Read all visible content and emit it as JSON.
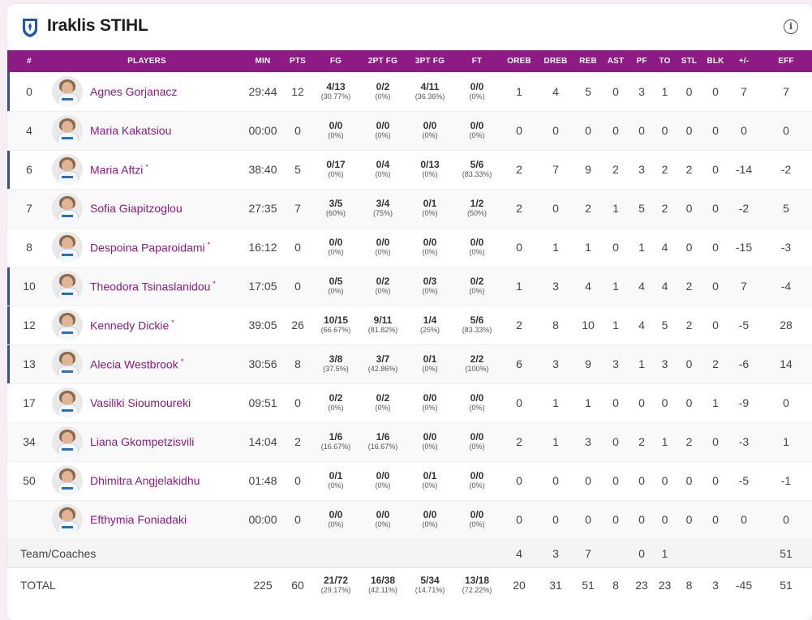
{
  "team": {
    "name": "Iraklis STIHL",
    "logo_icon": "iraklis-crest-icon",
    "info_icon": "info-icon"
  },
  "columns": [
    "#",
    "PLAYERS",
    "MIN",
    "PTS",
    "FG",
    "2PT FG",
    "3PT FG",
    "FT",
    "OREB",
    "DREB",
    "REB",
    "AST",
    "PF",
    "TO",
    "STL",
    "BLK",
    "+/-",
    "EFF"
  ],
  "players": [
    {
      "num": "0",
      "name": "Agnes Gorjanacz",
      "star": "",
      "starter": true,
      "min": "29:44",
      "pts": "12",
      "fg": "4/13",
      "fg_pct": "(30.77%)",
      "fg2": "0/2",
      "fg2_pct": "(0%)",
      "fg3": "4/11",
      "fg3_pct": "(36.36%)",
      "ft": "0/0",
      "ft_pct": "(0%)",
      "oreb": "1",
      "dreb": "4",
      "reb": "5",
      "ast": "0",
      "pf": "3",
      "to": "1",
      "stl": "0",
      "blk": "0",
      "pm": "7",
      "eff": "7"
    },
    {
      "num": "4",
      "name": "Maria Kakatsiou",
      "star": "",
      "starter": false,
      "min": "00:00",
      "pts": "0",
      "fg": "0/0",
      "fg_pct": "(0%)",
      "fg2": "0/0",
      "fg2_pct": "(0%)",
      "fg3": "0/0",
      "fg3_pct": "(0%)",
      "ft": "0/0",
      "ft_pct": "(0%)",
      "oreb": "0",
      "dreb": "0",
      "reb": "0",
      "ast": "0",
      "pf": "0",
      "to": "0",
      "stl": "0",
      "blk": "0",
      "pm": "0",
      "eff": "0"
    },
    {
      "num": "6",
      "name": "Maria Aftzi",
      "star": "*",
      "starter": true,
      "min": "38:40",
      "pts": "5",
      "fg": "0/17",
      "fg_pct": "(0%)",
      "fg2": "0/4",
      "fg2_pct": "(0%)",
      "fg3": "0/13",
      "fg3_pct": "(0%)",
      "ft": "5/6",
      "ft_pct": "(83.33%)",
      "oreb": "2",
      "dreb": "7",
      "reb": "9",
      "ast": "2",
      "pf": "3",
      "to": "2",
      "stl": "2",
      "blk": "0",
      "pm": "-14",
      "eff": "-2"
    },
    {
      "num": "7",
      "name": "Sofia Giapitzoglou",
      "star": "",
      "starter": false,
      "min": "27:35",
      "pts": "7",
      "fg": "3/5",
      "fg_pct": "(60%)",
      "fg2": "3/4",
      "fg2_pct": "(75%)",
      "fg3": "0/1",
      "fg3_pct": "(0%)",
      "ft": "1/2",
      "ft_pct": "(50%)",
      "oreb": "2",
      "dreb": "0",
      "reb": "2",
      "ast": "1",
      "pf": "5",
      "to": "2",
      "stl": "0",
      "blk": "0",
      "pm": "-2",
      "eff": "5"
    },
    {
      "num": "8",
      "name": "Despoina Paparoidami",
      "star": "*",
      "starter": false,
      "min": "16:12",
      "pts": "0",
      "fg": "0/0",
      "fg_pct": "(0%)",
      "fg2": "0/0",
      "fg2_pct": "(0%)",
      "fg3": "0/0",
      "fg3_pct": "(0%)",
      "ft": "0/0",
      "ft_pct": "(0%)",
      "oreb": "0",
      "dreb": "1",
      "reb": "1",
      "ast": "0",
      "pf": "1",
      "to": "4",
      "stl": "0",
      "blk": "0",
      "pm": "-15",
      "eff": "-3"
    },
    {
      "num": "10",
      "name": "Theodora Tsinaslanidou",
      "star": "*",
      "starter": true,
      "min": "17:05",
      "pts": "0",
      "fg": "0/5",
      "fg_pct": "(0%)",
      "fg2": "0/2",
      "fg2_pct": "(0%)",
      "fg3": "0/3",
      "fg3_pct": "(0%)",
      "ft": "0/2",
      "ft_pct": "(0%)",
      "oreb": "1",
      "dreb": "3",
      "reb": "4",
      "ast": "1",
      "pf": "4",
      "to": "4",
      "stl": "2",
      "blk": "0",
      "pm": "7",
      "eff": "-4"
    },
    {
      "num": "12",
      "name": "Kennedy Dickie",
      "star": "*",
      "starter": true,
      "min": "39:05",
      "pts": "26",
      "fg": "10/15",
      "fg_pct": "(66.67%)",
      "fg2": "9/11",
      "fg2_pct": "(81.82%)",
      "fg3": "1/4",
      "fg3_pct": "(25%)",
      "ft": "5/6",
      "ft_pct": "(83.33%)",
      "oreb": "2",
      "dreb": "8",
      "reb": "10",
      "ast": "1",
      "pf": "4",
      "to": "5",
      "stl": "2",
      "blk": "0",
      "pm": "-5",
      "eff": "28"
    },
    {
      "num": "13",
      "name": "Alecia Westbrook",
      "star": "*",
      "starter": true,
      "min": "30:56",
      "pts": "8",
      "fg": "3/8",
      "fg_pct": "(37.5%)",
      "fg2": "3/7",
      "fg2_pct": "(42.86%)",
      "fg3": "0/1",
      "fg3_pct": "(0%)",
      "ft": "2/2",
      "ft_pct": "(100%)",
      "oreb": "6",
      "dreb": "3",
      "reb": "9",
      "ast": "3",
      "pf": "1",
      "to": "3",
      "stl": "0",
      "blk": "2",
      "pm": "-6",
      "eff": "14"
    },
    {
      "num": "17",
      "name": "Vasiliki Sioumoureki",
      "star": "",
      "starter": false,
      "min": "09:51",
      "pts": "0",
      "fg": "0/2",
      "fg_pct": "(0%)",
      "fg2": "0/2",
      "fg2_pct": "(0%)",
      "fg3": "0/0",
      "fg3_pct": "(0%)",
      "ft": "0/0",
      "ft_pct": "(0%)",
      "oreb": "0",
      "dreb": "1",
      "reb": "1",
      "ast": "0",
      "pf": "0",
      "to": "0",
      "stl": "0",
      "blk": "1",
      "pm": "-9",
      "eff": "0"
    },
    {
      "num": "34",
      "name": "Liana Gkompetzisvili",
      "star": "",
      "starter": false,
      "min": "14:04",
      "pts": "2",
      "fg": "1/6",
      "fg_pct": "(16.67%)",
      "fg2": "1/6",
      "fg2_pct": "(16.67%)",
      "fg3": "0/0",
      "fg3_pct": "(0%)",
      "ft": "0/0",
      "ft_pct": "(0%)",
      "oreb": "2",
      "dreb": "1",
      "reb": "3",
      "ast": "0",
      "pf": "2",
      "to": "1",
      "stl": "2",
      "blk": "0",
      "pm": "-3",
      "eff": "1"
    },
    {
      "num": "50",
      "name": "Dhimitra Angjelakidhu",
      "star": "",
      "starter": false,
      "min": "01:48",
      "pts": "0",
      "fg": "0/1",
      "fg_pct": "(0%)",
      "fg2": "0/0",
      "fg2_pct": "(0%)",
      "fg3": "0/1",
      "fg3_pct": "(0%)",
      "ft": "0/0",
      "ft_pct": "(0%)",
      "oreb": "0",
      "dreb": "0",
      "reb": "0",
      "ast": "0",
      "pf": "0",
      "to": "0",
      "stl": "0",
      "blk": "0",
      "pm": "-5",
      "eff": "-1"
    },
    {
      "num": "",
      "name": "Efthymia Foniadaki",
      "star": "",
      "starter": false,
      "min": "00:00",
      "pts": "0",
      "fg": "0/0",
      "fg_pct": "(0%)",
      "fg2": "0/0",
      "fg2_pct": "(0%)",
      "fg3": "0/0",
      "fg3_pct": "(0%)",
      "ft": "0/0",
      "ft_pct": "(0%)",
      "oreb": "0",
      "dreb": "0",
      "reb": "0",
      "ast": "0",
      "pf": "0",
      "to": "0",
      "stl": "0",
      "blk": "0",
      "pm": "0",
      "eff": "0"
    }
  ],
  "team_coaches": {
    "label": "Team/Coaches",
    "oreb": "4",
    "dreb": "3",
    "reb": "7",
    "ast": "",
    "pf": "0",
    "to": "1",
    "stl": "",
    "blk": "",
    "pm": "",
    "eff": "51"
  },
  "total": {
    "label": "TOTAL",
    "min": "225",
    "pts": "60",
    "fg": "21/72",
    "fg_pct": "(29.17%)",
    "fg2": "16/38",
    "fg2_pct": "(42.11%)",
    "fg3": "5/34",
    "fg3_pct": "(14.71%)",
    "ft": "13/18",
    "ft_pct": "(72.22%)",
    "oreb": "20",
    "dreb": "31",
    "reb": "51",
    "ast": "8",
    "pf": "23",
    "to": "23",
    "stl": "8",
    "blk": "3",
    "pm": "-45",
    "eff": "51"
  },
  "colors": {
    "header_bg": "#8e1a86",
    "player_link": "#8e1a86",
    "starter_marker": "#1d5aa6"
  }
}
